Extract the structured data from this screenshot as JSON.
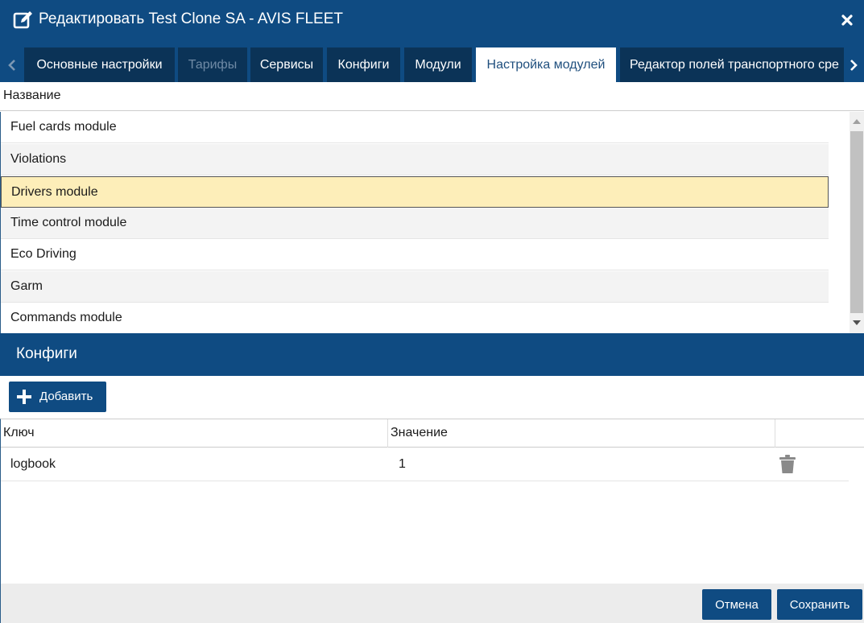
{
  "window": {
    "title": "Редактировать Test Clone SA - AVIS FLEET",
    "title_icon": "edit-icon",
    "close_icon": "close-icon"
  },
  "tabs": [
    {
      "label": "Основные настройки",
      "state": "normal"
    },
    {
      "label": "Тарифы",
      "state": "disabled"
    },
    {
      "label": "Сервисы",
      "state": "normal"
    },
    {
      "label": "Конфиги",
      "state": "normal"
    },
    {
      "label": "Модули",
      "state": "normal"
    },
    {
      "label": "Настройка модулей",
      "state": "active"
    },
    {
      "label": "Редактор полей транспортного сре",
      "state": "normal"
    }
  ],
  "modules_grid": {
    "column_header": "Название",
    "rows": [
      "Fuel cards module",
      "Violations",
      "Drivers module",
      "Time control module",
      "Eco Driving",
      "Garm",
      "Commands module"
    ],
    "selected_row": "Drivers module"
  },
  "configs": {
    "title": "Конфиги",
    "add_button": "Добавить",
    "columns": {
      "key": "Ключ",
      "value": "Значение"
    },
    "rows": [
      {
        "key": "logbook",
        "value": "1"
      }
    ],
    "row_action_icon": "trash-icon"
  },
  "footer": {
    "cancel": "Отмена",
    "save": "Сохранить"
  },
  "colors": {
    "header_bg": "#0f4b82",
    "tab_bg": "#0b3357",
    "selected_row_bg": "#fdeeb9",
    "button_bg": "#0f4b82"
  }
}
